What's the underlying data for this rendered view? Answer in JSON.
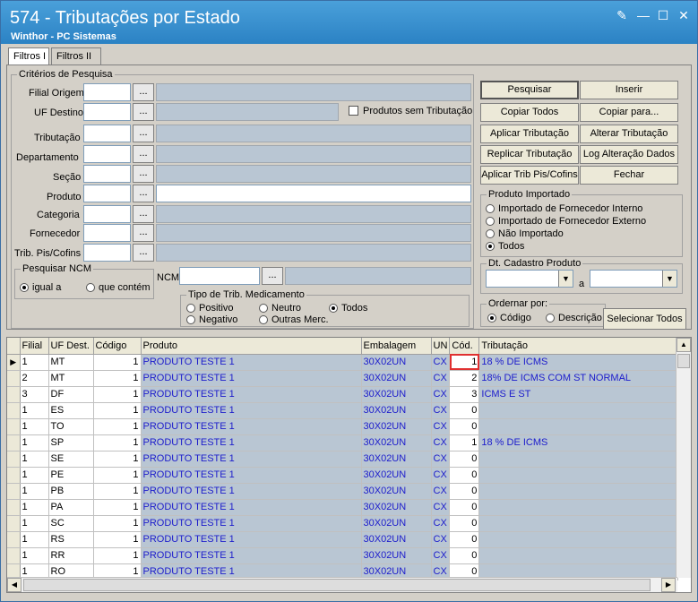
{
  "window": {
    "title": "574 - Tributações por Estado",
    "subtitle": "Winthor - PC Sistemas"
  },
  "tabs": [
    "Filtros I",
    "Filtros II"
  ],
  "criterios": {
    "legend": "Critérios de Pesquisa",
    "filial_origem": "Filial Origem",
    "uf_destino": "UF Destino",
    "tributacao": "Tributação",
    "departamento": "Departamento",
    "secao": "Seção",
    "produto": "Produto",
    "categoria": "Categoria",
    "fornecedor": "Fornecedor",
    "trib_pis": "Trib. Pis/Cofins",
    "dots": "...",
    "sem_trib": "Produtos sem Tributação",
    "ncm": "NCM"
  },
  "pesquisar_ncm": {
    "legend": "Pesquisar NCM",
    "igual": "igual a",
    "contem": "que contém"
  },
  "medicamento": {
    "legend": "Tipo de Trib. Medicamento",
    "positivo": "Positivo",
    "neutro": "Neutro",
    "todos": "Todos",
    "negativo": "Negativo",
    "outras": "Outras Merc."
  },
  "buttons": {
    "pesquisar": "Pesquisar",
    "inserir": "Inserir",
    "copiar_todos": "Copiar Todos",
    "copiar_para": "Copiar para...",
    "aplicar_trib": "Aplicar Tributação",
    "alterar_trib": "Alterar Tributação",
    "replicar_trib": "Replicar Tributação",
    "log": "Log Alteração Dados",
    "aplicar_pis": "Aplicar Trib Pis/Cofins",
    "fechar": "Fechar",
    "selecionar_todos": "Selecionar Todos"
  },
  "produto_importado": {
    "legend": "Produto Importado",
    "opt1": "Importado de Fornecedor Interno",
    "opt2": "Importado de Fornecedor Externo",
    "opt3": "Não Importado",
    "opt4": "Todos"
  },
  "dt_cadastro": {
    "legend": "Dt. Cadastro Produto",
    "a": "a"
  },
  "ordenar": {
    "legend": "Ordernar por:",
    "codigo": "Código",
    "descricao": "Descrição"
  },
  "grid": {
    "headers": [
      "Filial",
      "UF Dest.",
      "Código",
      "Produto",
      "Embalagem",
      "UN",
      "Cód.",
      "Tributação"
    ],
    "rows": [
      [
        "1",
        "MT",
        "1",
        "PRODUTO TESTE 1",
        "30X02UN",
        "CX",
        "1",
        "18 % DE ICMS"
      ],
      [
        "2",
        "MT",
        "1",
        "PRODUTO TESTE 1",
        "30X02UN",
        "CX",
        "2",
        "18% DE ICMS COM ST NORMAL"
      ],
      [
        "3",
        "DF",
        "1",
        "PRODUTO TESTE 1",
        "30X02UN",
        "CX",
        "3",
        "ICMS E ST"
      ],
      [
        "1",
        "ES",
        "1",
        "PRODUTO TESTE 1",
        "30X02UN",
        "CX",
        "0",
        ""
      ],
      [
        "1",
        "TO",
        "1",
        "PRODUTO TESTE 1",
        "30X02UN",
        "CX",
        "0",
        ""
      ],
      [
        "1",
        "SP",
        "1",
        "PRODUTO TESTE 1",
        "30X02UN",
        "CX",
        "1",
        "18 % DE ICMS"
      ],
      [
        "1",
        "SE",
        "1",
        "PRODUTO TESTE 1",
        "30X02UN",
        "CX",
        "0",
        ""
      ],
      [
        "1",
        "PE",
        "1",
        "PRODUTO TESTE 1",
        "30X02UN",
        "CX",
        "0",
        ""
      ],
      [
        "1",
        "PB",
        "1",
        "PRODUTO TESTE 1",
        "30X02UN",
        "CX",
        "0",
        ""
      ],
      [
        "1",
        "PA",
        "1",
        "PRODUTO TESTE 1",
        "30X02UN",
        "CX",
        "0",
        ""
      ],
      [
        "1",
        "SC",
        "1",
        "PRODUTO TESTE 1",
        "30X02UN",
        "CX",
        "0",
        ""
      ],
      [
        "1",
        "RS",
        "1",
        "PRODUTO TESTE 1",
        "30X02UN",
        "CX",
        "0",
        ""
      ],
      [
        "1",
        "RR",
        "1",
        "PRODUTO TESTE 1",
        "30X02UN",
        "CX",
        "0",
        ""
      ],
      [
        "1",
        "RO",
        "1",
        "PRODUTO TESTE 1",
        "30X02UN",
        "CX",
        "0",
        ""
      ]
    ]
  }
}
